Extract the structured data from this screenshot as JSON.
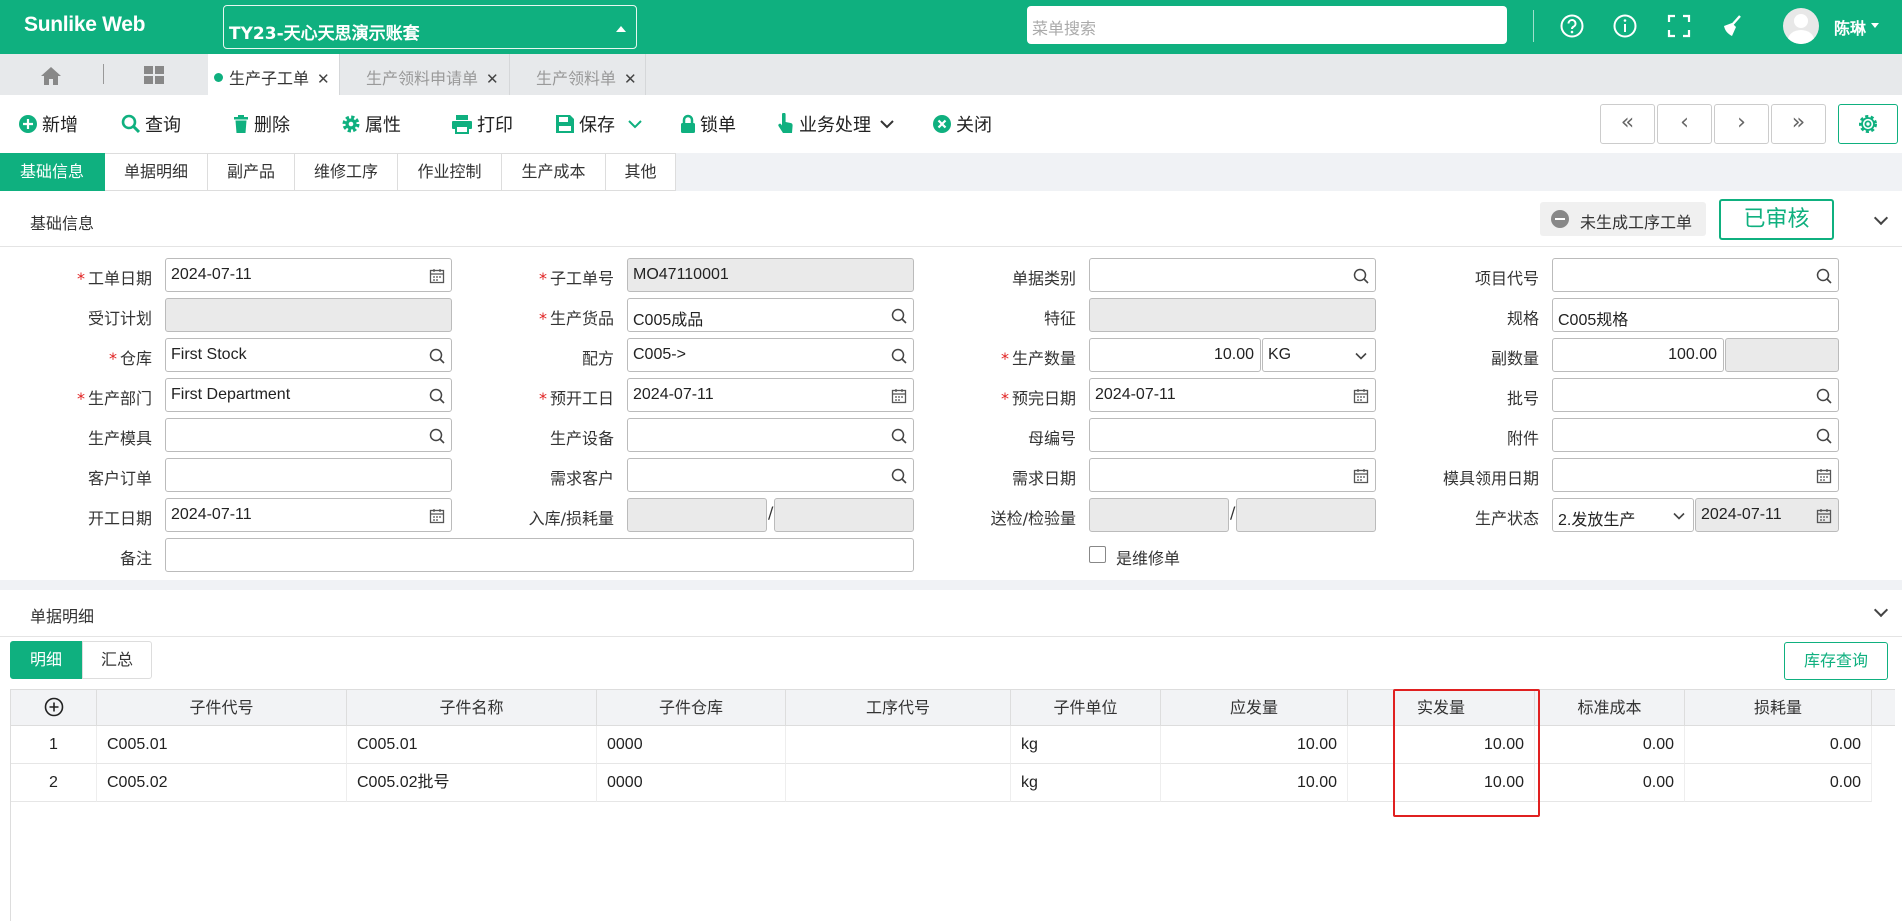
{
  "topbar": {
    "brand": "Sunlike Web",
    "account": "TY23-天心天思演示账套",
    "menu_search_placeholder": "菜单搜索",
    "username": "陈琳"
  },
  "tabs": [
    {
      "label": "生产子工单",
      "active": true
    },
    {
      "label": "生产领料申请单",
      "active": false
    },
    {
      "label": "生产领料单",
      "active": false
    }
  ],
  "toolbar": {
    "new": "新增",
    "query": "查询",
    "delete": "删除",
    "properties": "属性",
    "print": "打印",
    "save": "保存",
    "lock": "锁单",
    "business": "业务处理",
    "close": "关闭"
  },
  "section_tabs": [
    "基础信息",
    "单据明细",
    "副产品",
    "维修工序",
    "作业控制",
    "生产成本",
    "其他"
  ],
  "basic": {
    "title": "基础信息",
    "status_chip": "未生成工序工单",
    "stamp": "已审核",
    "labels": {
      "order_date": "工单日期",
      "sub_order_no": "子工单号",
      "doc_type": "单据类别",
      "project_code": "项目代号",
      "order_plan": "受订计划",
      "product": "生产货品",
      "feature": "特征",
      "spec": "规格",
      "warehouse": "仓库",
      "formula": "配方",
      "prod_qty": "生产数量",
      "sub_qty": "副数量",
      "dept": "生产部门",
      "plan_start": "预开工日",
      "plan_finish": "预完日期",
      "batch": "批号",
      "mold": "生产模具",
      "equipment": "生产设备",
      "parent_no": "母编号",
      "attachment": "附件",
      "customer_order": "客户订单",
      "demand_customer": "需求客户",
      "demand_date": "需求日期",
      "mold_date": "模具领用日期",
      "start_date": "开工日期",
      "in_loss": "入库/损耗量",
      "send_inspect": "送检/检验量",
      "prod_status": "生产状态",
      "remark": "备注",
      "is_repair": "是维修单"
    },
    "values": {
      "order_date": "2024-07-11",
      "sub_order_no": "MO47110001",
      "spec": "C005规格",
      "warehouse": "First Stock",
      "product": "C005成品",
      "formula": "C005->",
      "prod_qty": "10.00",
      "unit": "KG",
      "sub_qty": "100.00",
      "dept": "First Department",
      "plan_start": "2024-07-11",
      "plan_finish": "2024-07-11",
      "start_date": "2024-07-11",
      "prod_status": "2.发放生产",
      "status_date": "2024-07-11"
    }
  },
  "detail": {
    "title": "单据明细",
    "subtabs": [
      "明细",
      "汇总"
    ],
    "stock_query": "库存查询",
    "columns": [
      "子件代号",
      "子件名称",
      "子件仓库",
      "工序代号",
      "子件单位",
      "应发量",
      "实发量",
      "标准成本",
      "损耗量"
    ],
    "rows": [
      {
        "no": "1",
        "code": "C005.01",
        "name": "C005.01",
        "wh": "0000",
        "op": "",
        "unit": "kg",
        "req": "10.00",
        "act": "10.00",
        "cost": "0.00",
        "loss": "0.00"
      },
      {
        "no": "2",
        "code": "C005.02",
        "name": "C005.02批号",
        "wh": "0000",
        "op": "",
        "unit": "kg",
        "req": "10.00",
        "act": "10.00",
        "cost": "0.00",
        "loss": "0.00"
      }
    ]
  },
  "colors": {
    "accent": "#0fb07f",
    "required": "#e02020",
    "highlight": "#e02020"
  }
}
